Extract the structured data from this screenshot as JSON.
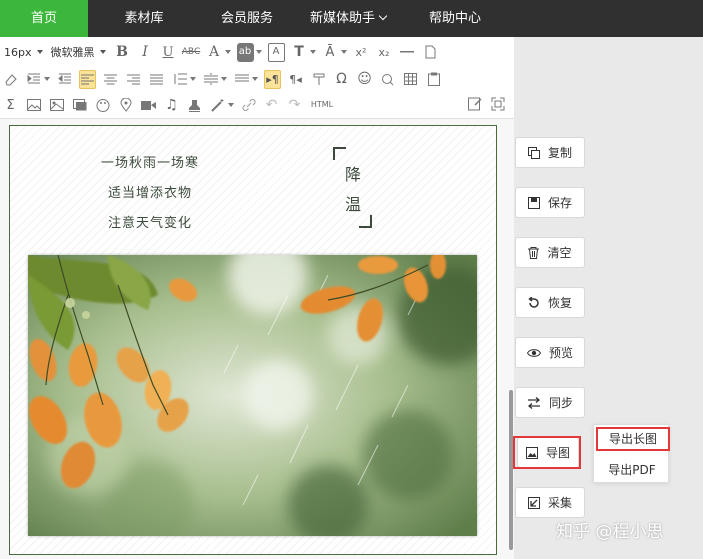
{
  "nav": {
    "items": [
      {
        "label": "首页",
        "active": true
      },
      {
        "label": "素材库"
      },
      {
        "label": "会员服务"
      },
      {
        "label": "新媒体助手",
        "dropdown": true
      },
      {
        "label": "帮助中心"
      }
    ]
  },
  "toolbar": {
    "font_size": "16px",
    "font_family": "微软雅黑",
    "html_label": "HTML",
    "row1_icons": [
      "bold-icon",
      "italic-icon",
      "underline-icon",
      "strikethrough-icon",
      "font-color-icon",
      "highlight-icon",
      "border-text-icon",
      "text-size-icon",
      "text-case-icon",
      "superscript-icon",
      "subscript-icon",
      "horizontal-line-icon",
      "new-doc-icon"
    ],
    "row2_icons": [
      "eraser-icon",
      "indent-icon",
      "outdent-icon",
      "align-left-icon",
      "align-center-icon",
      "align-right-icon",
      "align-justify-icon",
      "line-height-icon",
      "paragraph-spacing-icon",
      "letter-spacing-icon",
      "ltr-icon",
      "rtl-icon",
      "format-icon",
      "omega-icon",
      "emoji-icon",
      "find-icon",
      "table-icon",
      "paste-icon"
    ],
    "row3_icons": [
      "sum-icon",
      "image-icon",
      "image-multi-icon",
      "frame-icon",
      "palette-icon",
      "map-icon",
      "video-icon",
      "music-icon",
      "stamp-icon",
      "magic-wand-icon",
      "link-icon",
      "undo-icon",
      "redo-icon",
      "edit-icon",
      "fullscreen-icon"
    ]
  },
  "article": {
    "poem": [
      "一场秋雨一场寒",
      "适当增添衣物",
      "注意天气变化"
    ],
    "title_chars": [
      "降",
      "温"
    ]
  },
  "side_buttons": [
    {
      "label": "复制",
      "icon": "copy-icon"
    },
    {
      "label": "保存",
      "icon": "save-icon"
    },
    {
      "label": "清空",
      "icon": "trash-icon"
    },
    {
      "label": "恢复",
      "icon": "restore-icon"
    },
    {
      "label": "预览",
      "icon": "eye-icon"
    },
    {
      "label": "同步",
      "icon": "sync-icon"
    },
    {
      "label": "导图",
      "icon": "export-image-icon",
      "highlighted": true
    },
    {
      "label": "采集",
      "icon": "collect-icon"
    }
  ],
  "export_menu": {
    "items": [
      "导出长图",
      "导出PDF"
    ]
  },
  "watermark": "知乎 @程小思",
  "colors": {
    "nav_bg": "#303030",
    "nav_active": "#3db73b",
    "highlight_red": "#e23838",
    "selected_tool": "#fbe39a"
  }
}
